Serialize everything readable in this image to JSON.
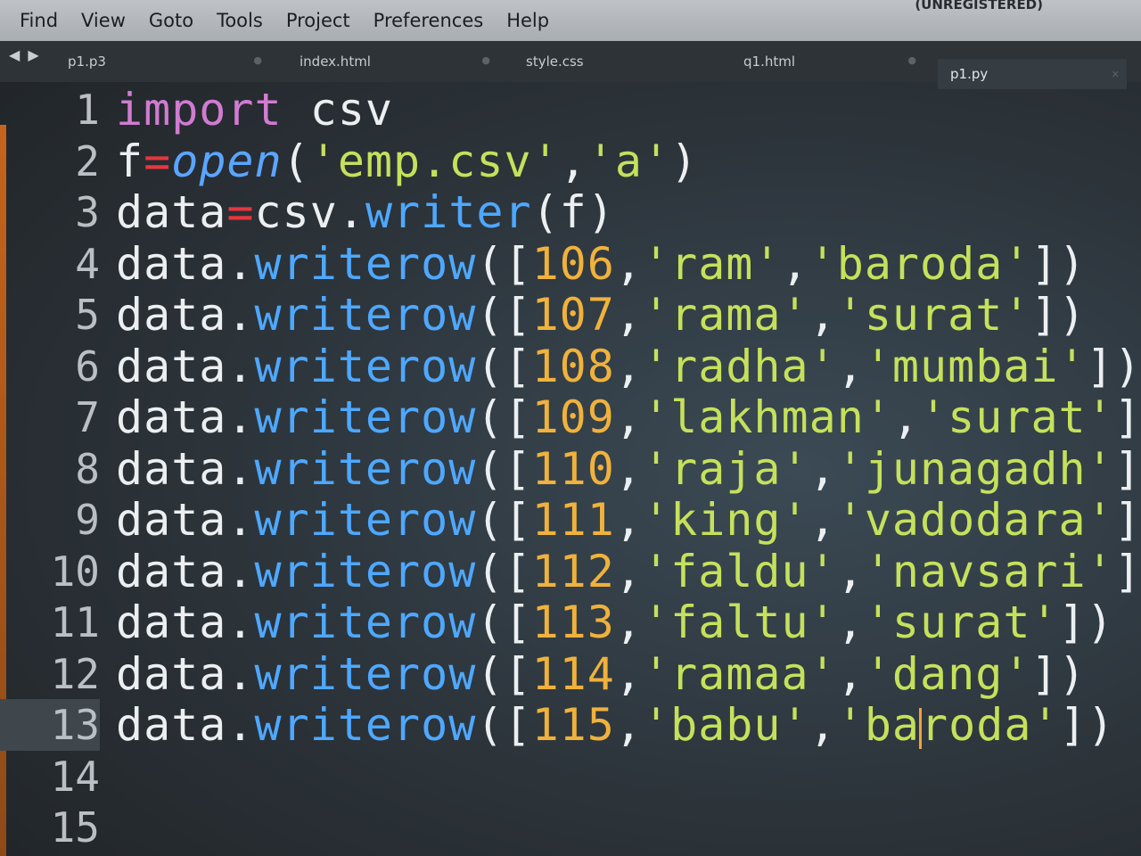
{
  "menu": [
    "Find",
    "View",
    "Goto",
    "Tools",
    "Project",
    "Preferences",
    "Help"
  ],
  "registered": "(UNREGISTERED)",
  "nav_arrows": "◀ ▶",
  "tabs": [
    {
      "label": "p1.p3",
      "active": false
    },
    {
      "label": "index.html",
      "active": false
    },
    {
      "label": "style.css",
      "active": false
    },
    {
      "label": "q1.html",
      "active": false
    },
    {
      "label": "p1.py",
      "active": true
    }
  ],
  "editor": {
    "current_line": 13,
    "lines": [
      {
        "num": "1",
        "tokens": [
          [
            "kw",
            "import"
          ],
          [
            "name",
            " csv"
          ]
        ]
      },
      {
        "num": "2",
        "tokens": [
          [
            "name",
            "f"
          ],
          [
            "op",
            "="
          ],
          [
            "fn",
            "open"
          ],
          [
            "punct",
            "("
          ],
          [
            "str",
            "'emp.csv'"
          ],
          [
            "punct",
            ","
          ],
          [
            "str",
            "'a'"
          ],
          [
            "punct",
            ")"
          ]
        ]
      },
      {
        "num": "3",
        "tokens": [
          [
            "name",
            "data"
          ],
          [
            "op",
            "="
          ],
          [
            "name",
            "csv."
          ],
          [
            "method",
            "writer"
          ],
          [
            "punct",
            "(f)"
          ]
        ]
      },
      {
        "num": "4",
        "tokens": [
          [
            "name",
            "data."
          ],
          [
            "method",
            "writerow"
          ],
          [
            "punct",
            "(["
          ],
          [
            "num",
            "106"
          ],
          [
            "punct",
            ","
          ],
          [
            "str",
            "'ram'"
          ],
          [
            "punct",
            ","
          ],
          [
            "str",
            "'baroda'"
          ],
          [
            "punct",
            "])"
          ]
        ]
      },
      {
        "num": "5",
        "tokens": [
          [
            "name",
            "data."
          ],
          [
            "method",
            "writerow"
          ],
          [
            "punct",
            "(["
          ],
          [
            "num",
            "107"
          ],
          [
            "punct",
            ","
          ],
          [
            "str",
            "'rama'"
          ],
          [
            "punct",
            ","
          ],
          [
            "str",
            "'surat'"
          ],
          [
            "punct",
            "])"
          ]
        ]
      },
      {
        "num": "6",
        "tokens": [
          [
            "name",
            "data."
          ],
          [
            "method",
            "writerow"
          ],
          [
            "punct",
            "(["
          ],
          [
            "num",
            "108"
          ],
          [
            "punct",
            ","
          ],
          [
            "str",
            "'radha'"
          ],
          [
            "punct",
            ","
          ],
          [
            "str",
            "'mumbai'"
          ],
          [
            "punct",
            "])"
          ]
        ]
      },
      {
        "num": "7",
        "tokens": [
          [
            "name",
            "data."
          ],
          [
            "method",
            "writerow"
          ],
          [
            "punct",
            "(["
          ],
          [
            "num",
            "109"
          ],
          [
            "punct",
            ","
          ],
          [
            "str",
            "'lakhman'"
          ],
          [
            "punct",
            ","
          ],
          [
            "str",
            "'surat'"
          ],
          [
            "punct",
            "])"
          ]
        ]
      },
      {
        "num": "8",
        "tokens": [
          [
            "name",
            "data."
          ],
          [
            "method",
            "writerow"
          ],
          [
            "punct",
            "(["
          ],
          [
            "num",
            "110"
          ],
          [
            "punct",
            ","
          ],
          [
            "str",
            "'raja'"
          ],
          [
            "punct",
            ","
          ],
          [
            "str",
            "'junagadh'"
          ],
          [
            "punct",
            "])"
          ]
        ]
      },
      {
        "num": "9",
        "tokens": [
          [
            "name",
            "data."
          ],
          [
            "method",
            "writerow"
          ],
          [
            "punct",
            "(["
          ],
          [
            "num",
            "111"
          ],
          [
            "punct",
            ","
          ],
          [
            "str",
            "'king'"
          ],
          [
            "punct",
            ","
          ],
          [
            "str",
            "'vadodara'"
          ],
          [
            "punct",
            "])"
          ]
        ]
      },
      {
        "num": "10",
        "tokens": [
          [
            "name",
            "data."
          ],
          [
            "method",
            "writerow"
          ],
          [
            "punct",
            "(["
          ],
          [
            "num",
            "112"
          ],
          [
            "punct",
            ","
          ],
          [
            "str",
            "'faldu'"
          ],
          [
            "punct",
            ","
          ],
          [
            "str",
            "'navsari'"
          ],
          [
            "punct",
            "])"
          ]
        ]
      },
      {
        "num": "11",
        "tokens": [
          [
            "name",
            "data."
          ],
          [
            "method",
            "writerow"
          ],
          [
            "punct",
            "(["
          ],
          [
            "num",
            "113"
          ],
          [
            "punct",
            ","
          ],
          [
            "str",
            "'faltu'"
          ],
          [
            "punct",
            ","
          ],
          [
            "str",
            "'surat'"
          ],
          [
            "punct",
            "])"
          ]
        ]
      },
      {
        "num": "12",
        "tokens": [
          [
            "name",
            "data."
          ],
          [
            "method",
            "writerow"
          ],
          [
            "punct",
            "(["
          ],
          [
            "num",
            "114"
          ],
          [
            "punct",
            ","
          ],
          [
            "str",
            "'ramaa'"
          ],
          [
            "punct",
            ","
          ],
          [
            "str",
            "'dang'"
          ],
          [
            "punct",
            "])"
          ]
        ]
      },
      {
        "num": "13",
        "tokens": [
          [
            "name",
            "data."
          ],
          [
            "method",
            "writerow"
          ],
          [
            "punct",
            "(["
          ],
          [
            "num",
            "115"
          ],
          [
            "punct",
            ","
          ],
          [
            "str",
            "'babu'"
          ],
          [
            "punct",
            ","
          ],
          [
            "str",
            "'ba"
          ],
          [
            "cursor",
            ""
          ],
          [
            "str",
            "roda'"
          ],
          [
            "punct",
            "])"
          ]
        ]
      },
      {
        "num": "14",
        "tokens": []
      },
      {
        "num": "15",
        "tokens": []
      }
    ]
  },
  "colors": {
    "keyword": "#d17bd1",
    "operator": "#e8363d",
    "function": "#5aa5ff",
    "string": "#c5e15b",
    "number": "#f0b23c",
    "cursor": "#f3a03c",
    "gutter_accent": "#c5641c"
  }
}
